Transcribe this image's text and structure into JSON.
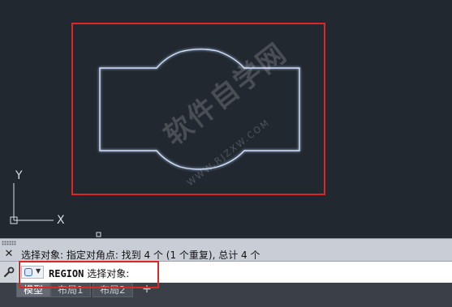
{
  "ucs": {
    "y_label": "Y",
    "x_label": "X"
  },
  "command_history": {
    "text": "选择对象: 指定对角点: 找到 4 个 (1 个重复), 总计 4 个"
  },
  "command_line": {
    "keyword": "REGION",
    "prompt": "选择对象:"
  },
  "tabs": [
    {
      "label": "模型"
    },
    {
      "label": "布局1"
    },
    {
      "label": "布局2"
    }
  ],
  "add_tab_label": "+",
  "icons": {
    "close": "close-icon",
    "wrench": "wrench-icon",
    "command": "command-dropdown-icon"
  },
  "colors": {
    "background": "#212830",
    "shape_stroke": "#e8eefc",
    "highlight": "#e02525"
  },
  "watermark": {
    "text": "软件自学网",
    "url": "WWW.RJZXW.COM"
  }
}
